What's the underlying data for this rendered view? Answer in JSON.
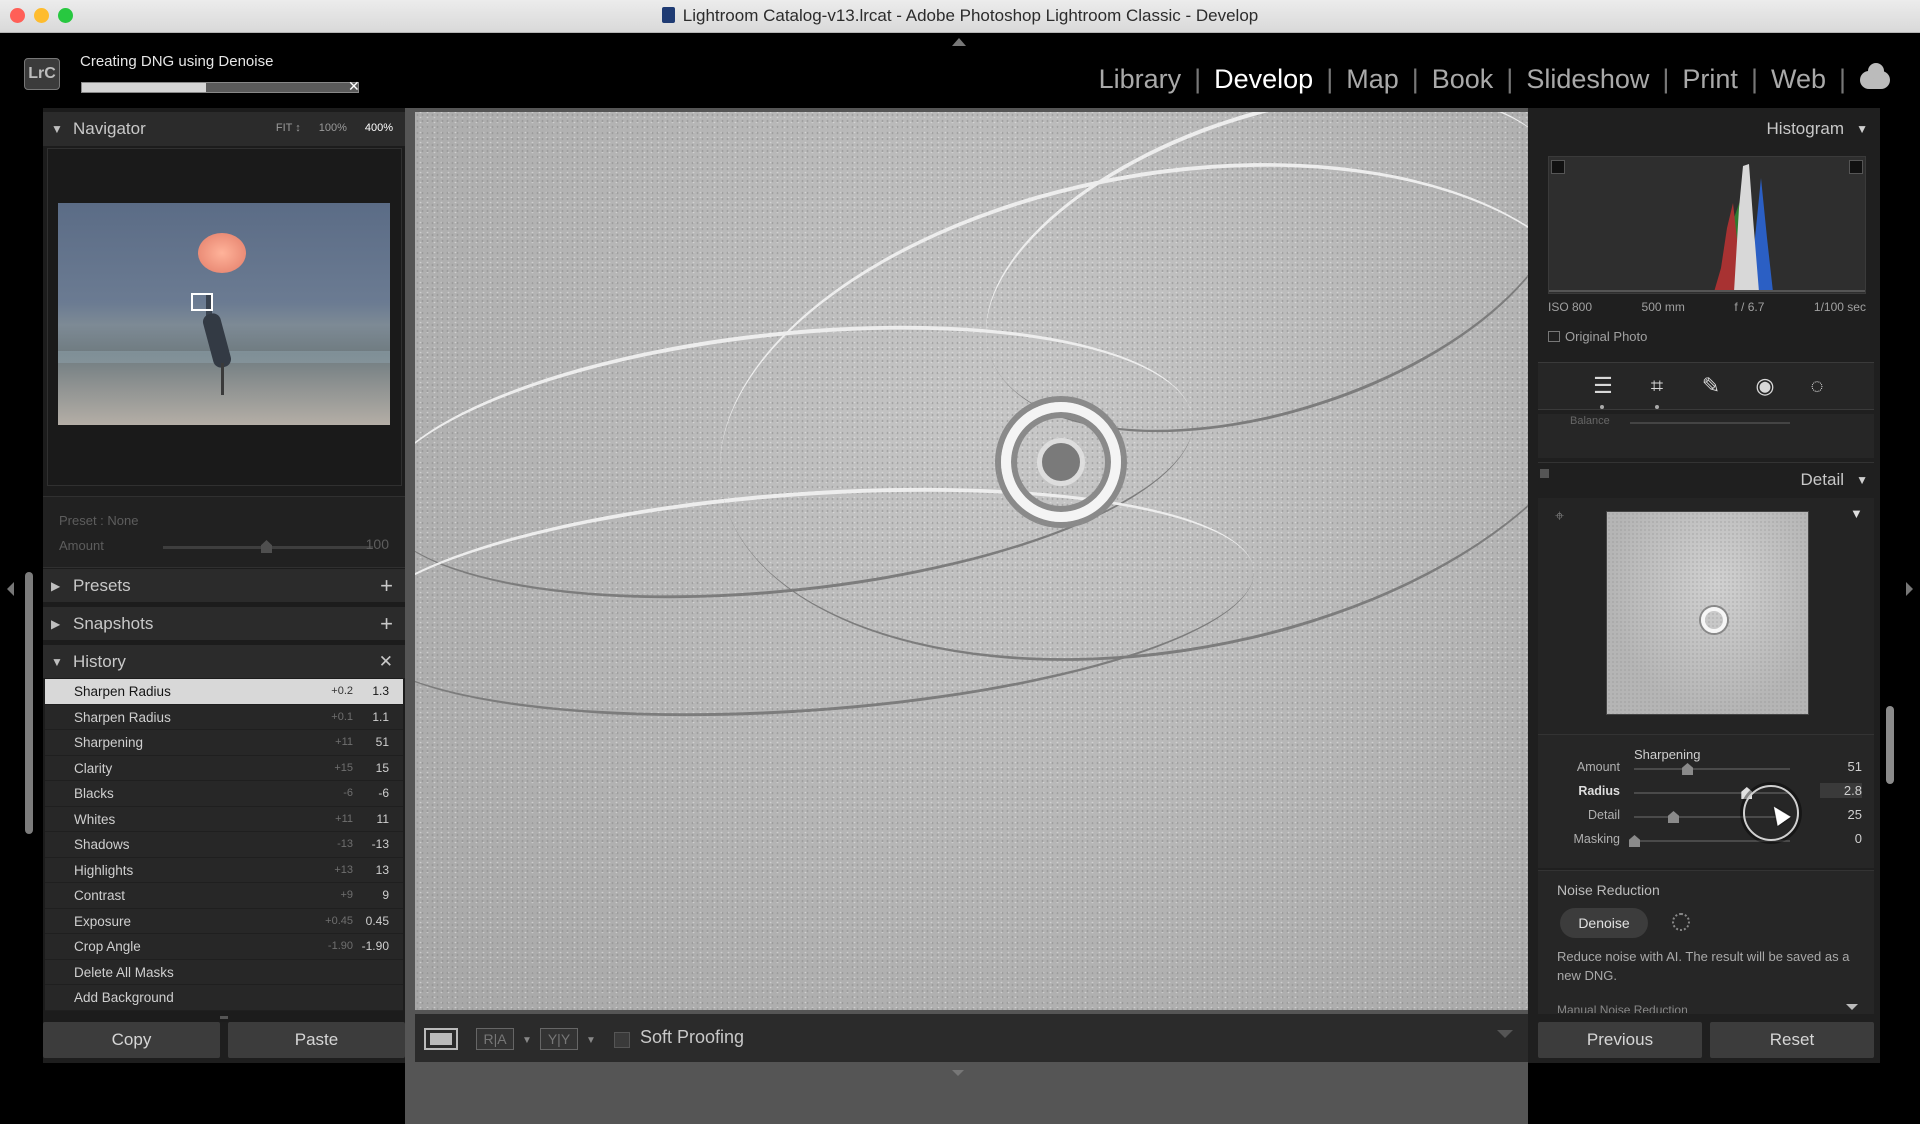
{
  "window": {
    "title": "Lightroom Catalog-v13.lrcat - Adobe Photoshop Lightroom Classic - Develop"
  },
  "task": {
    "label": "Creating DNG using Denoise",
    "progress": 0.45
  },
  "logo": "LrC",
  "modules": [
    "Library",
    "Develop",
    "Map",
    "Book",
    "Slideshow",
    "Print",
    "Web"
  ],
  "active_module": "Develop",
  "navigator": {
    "title": "Navigator",
    "zoom_options": [
      "FIT ↕",
      "100%",
      "400%"
    ],
    "selected_zoom": "400%"
  },
  "preset": {
    "label": "Preset : None",
    "amount_label": "Amount",
    "amount_value": "100"
  },
  "sections": {
    "presets": "Presets",
    "snapshots": "Snapshots",
    "history": "History"
  },
  "history": [
    {
      "name": "Sharpen Radius",
      "delta": "+0.2",
      "value": "1.3",
      "selected": true
    },
    {
      "name": "Sharpen Radius",
      "delta": "+0.1",
      "value": "1.1"
    },
    {
      "name": "Sharpening",
      "delta": "+11",
      "value": "51"
    },
    {
      "name": "Clarity",
      "delta": "+15",
      "value": "15"
    },
    {
      "name": "Blacks",
      "delta": "-6",
      "value": "-6"
    },
    {
      "name": "Whites",
      "delta": "+11",
      "value": "11"
    },
    {
      "name": "Shadows",
      "delta": "-13",
      "value": "-13"
    },
    {
      "name": "Highlights",
      "delta": "+13",
      "value": "13"
    },
    {
      "name": "Contrast",
      "delta": "+9",
      "value": "9"
    },
    {
      "name": "Exposure",
      "delta": "+0.45",
      "value": "0.45"
    },
    {
      "name": "Crop Angle",
      "delta": "-1.90",
      "value": "-1.90"
    },
    {
      "name": "Delete All Masks",
      "delta": "",
      "value": ""
    },
    {
      "name": "Add Background",
      "delta": "",
      "value": ""
    }
  ],
  "left_buttons": {
    "copy": "Copy",
    "paste": "Paste"
  },
  "toolbar": {
    "soft_proofing": "Soft Proofing",
    "before_after_ra": "R|A",
    "before_after_yy": "Y|Y"
  },
  "histogram": {
    "title": "Histogram",
    "iso": "ISO 800",
    "focal": "500 mm",
    "aperture": "f / 6.7",
    "shutter": "1/100 sec",
    "original_photo": "Original Photo"
  },
  "balance_label": "Balance",
  "detail": {
    "title": "Detail"
  },
  "sharpening": {
    "title": "Sharpening",
    "sliders": [
      {
        "label": "Amount",
        "value": "51",
        "fraction": 0.34
      },
      {
        "label": "Radius",
        "value": "2.8",
        "fraction": 0.72,
        "active": true
      },
      {
        "label": "Detail",
        "value": "25",
        "fraction": 0.25
      },
      {
        "label": "Masking",
        "value": "0",
        "fraction": 0.0
      }
    ]
  },
  "noise": {
    "title": "Noise Reduction",
    "denoise_label": "Denoise",
    "description": "Reduce noise with AI. The result will be saved as a new DNG.",
    "manual_label": "Manual Noise Reduction"
  },
  "right_buttons": {
    "previous": "Previous",
    "reset": "Reset"
  },
  "colors": {
    "accent": "#ffffff",
    "panel": "#232323",
    "selected_row": "#d8d8d8"
  }
}
